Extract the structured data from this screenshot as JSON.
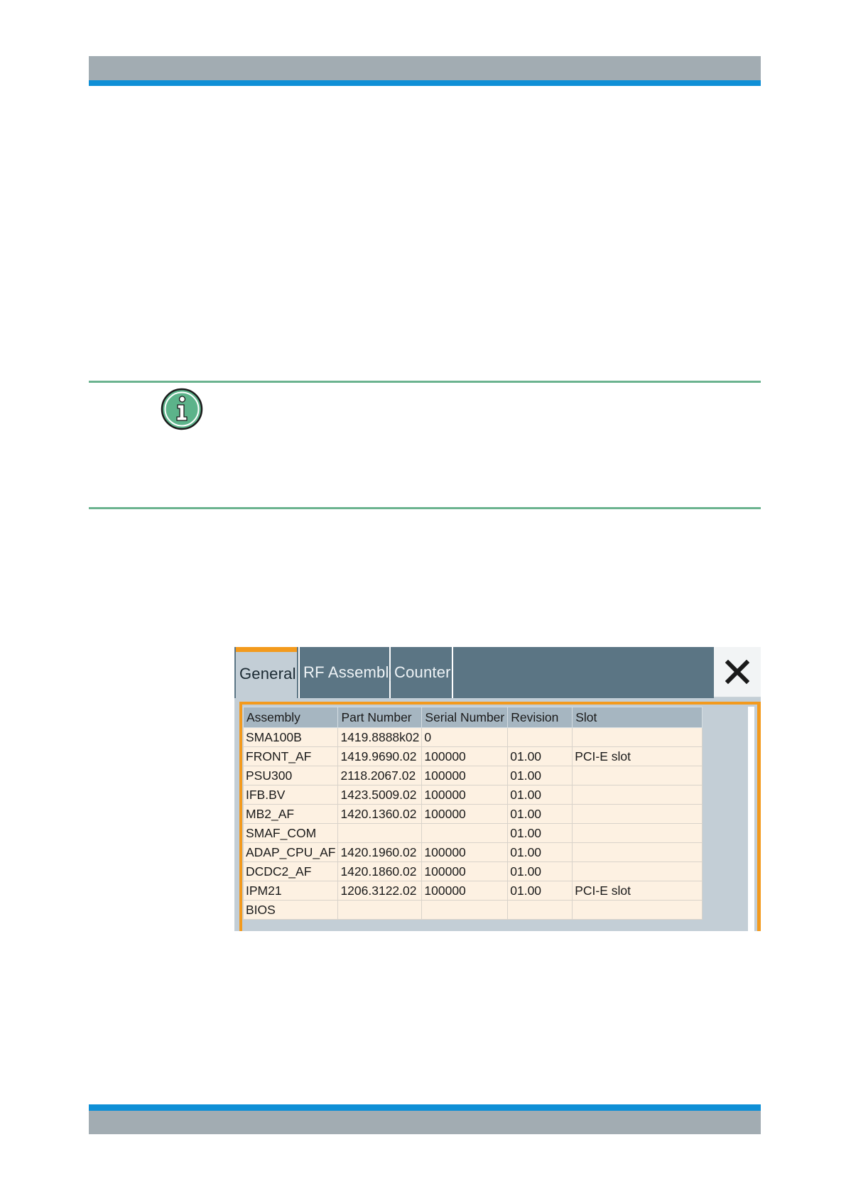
{
  "dialog": {
    "tabs": [
      {
        "label": "General",
        "active": true
      },
      {
        "label": "RF Assembly",
        "active": false
      },
      {
        "label": "Counter",
        "active": false
      }
    ],
    "close_icon": "close-icon",
    "table": {
      "headers": [
        "Assembly",
        "Part Number",
        "Serial Number",
        "Revision",
        "Slot"
      ],
      "rows": [
        [
          "SMA100B",
          "1419.8888k02",
          "0",
          "",
          ""
        ],
        [
          "FRONT_AF",
          "1419.9690.02",
          "100000",
          "01.00",
          "PCI-E slot"
        ],
        [
          "PSU300",
          "2118.2067.02",
          "100000",
          "01.00",
          ""
        ],
        [
          "IFB.BV",
          "1423.5009.02",
          "100000",
          "01.00",
          ""
        ],
        [
          "MB2_AF",
          "1420.1360.02",
          "100000",
          "01.00",
          ""
        ],
        [
          "SMAF_COM",
          "",
          "",
          "01.00",
          ""
        ],
        [
          "ADAP_CPU_AF",
          "1420.1960.02",
          "100000",
          "01.00",
          ""
        ],
        [
          "DCDC2_AF",
          "1420.1860.02",
          "100000",
          "01.00",
          ""
        ],
        [
          "IPM21",
          "1206.3122.02",
          "100000",
          "01.00",
          "PCI-E slot"
        ],
        [
          "BIOS",
          "",
          "",
          "",
          ""
        ]
      ]
    }
  },
  "icons": {
    "note": "info-icon"
  },
  "colors": {
    "accent_blue": "#0f8fd6",
    "header_gray": "#a2acb2",
    "note_rule_green": "#6bb38f",
    "tab_active_orange": "#f39a1d",
    "tab_bar": "#5b7584",
    "table_cell": "#fdf1e2",
    "table_header": "#a6b6c1"
  }
}
